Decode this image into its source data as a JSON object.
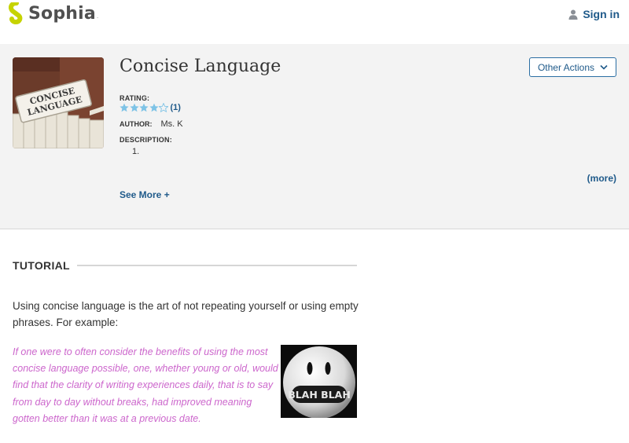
{
  "header": {
    "logo_text": "Sophia",
    "logo_mark": "trademark-dot",
    "signin_label": "Sign in",
    "brand_color": "#c6d300",
    "link_color": "#1f5a8a"
  },
  "summary": {
    "title": "Concise Language",
    "thumbnail_sign_text": "CONCISE LANGUAGE",
    "other_actions_label": "Other Actions",
    "rating_label": "RATING:",
    "rating_value": 4,
    "rating_max": 5,
    "rating_count": "(1)",
    "author_label": "AUTHOR:",
    "author_value": "Ms. K",
    "description_label": "DESCRIPTION:",
    "description_item": "1.",
    "more_label": "(more)",
    "see_more_label": "See More +"
  },
  "tutorial": {
    "section_title": "TUTORIAL",
    "intro": "Using concise language is the art of not repeating yourself or using empty phrases.  For example:",
    "example_text": "If one were to often consider the benefits of using the most concise language possible, one, whether young or old, would find that the clarity of writing experiences daily, that is to say from day to day without breaks, had improved meaning gotten better than it was at a previous date.",
    "image_text": "BLAH BLAH",
    "example_color": "#cc66cc"
  }
}
